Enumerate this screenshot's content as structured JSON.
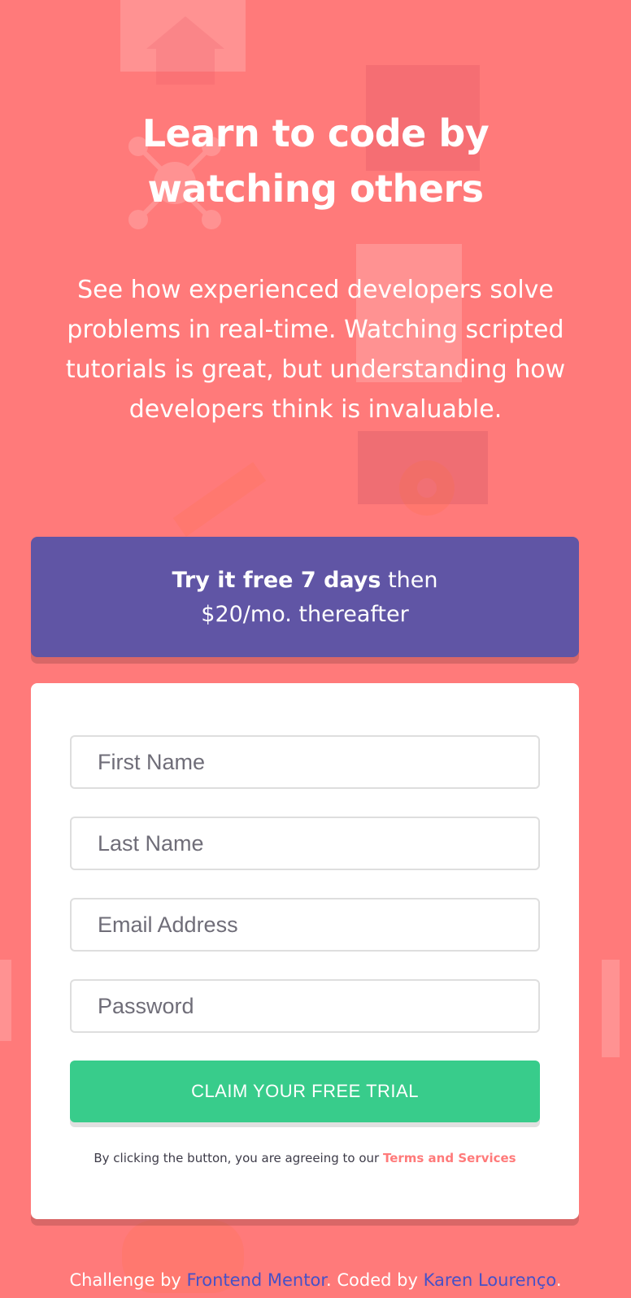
{
  "headline": {
    "line1": "Learn to code by",
    "line2": "watching others"
  },
  "intro_text": "See how experienced developers solve problems in real-time. Watching scripted tutorials is great, but understanding how developers think is invaluable.",
  "promo": {
    "bold_text": "Try it free 7 days",
    "normal_text": " then",
    "second_line": "$20/mo. thereafter",
    "background": "#6055a5"
  },
  "form": {
    "first_name_placeholder": "First Name",
    "last_name_placeholder": "Last Name",
    "email_placeholder": "Email Address",
    "password_placeholder": "Password",
    "submit_label": "CLAIM YOUR FREE TRIAL",
    "submit_color": "#38cc8b",
    "terms_prefix": "By clicking the button, you are agreeing to our ",
    "terms_link": "Terms and Services",
    "terms_color": "#ff7a7a"
  },
  "footer": {
    "prefix": "Challenge by ",
    "link1": "Frontend Mentor",
    "middle": ". Coded by ",
    "link2": "Karen Lourenço",
    "suffix": ".",
    "link_color": "#4651c7"
  },
  "background_color": "#ff7a7a"
}
